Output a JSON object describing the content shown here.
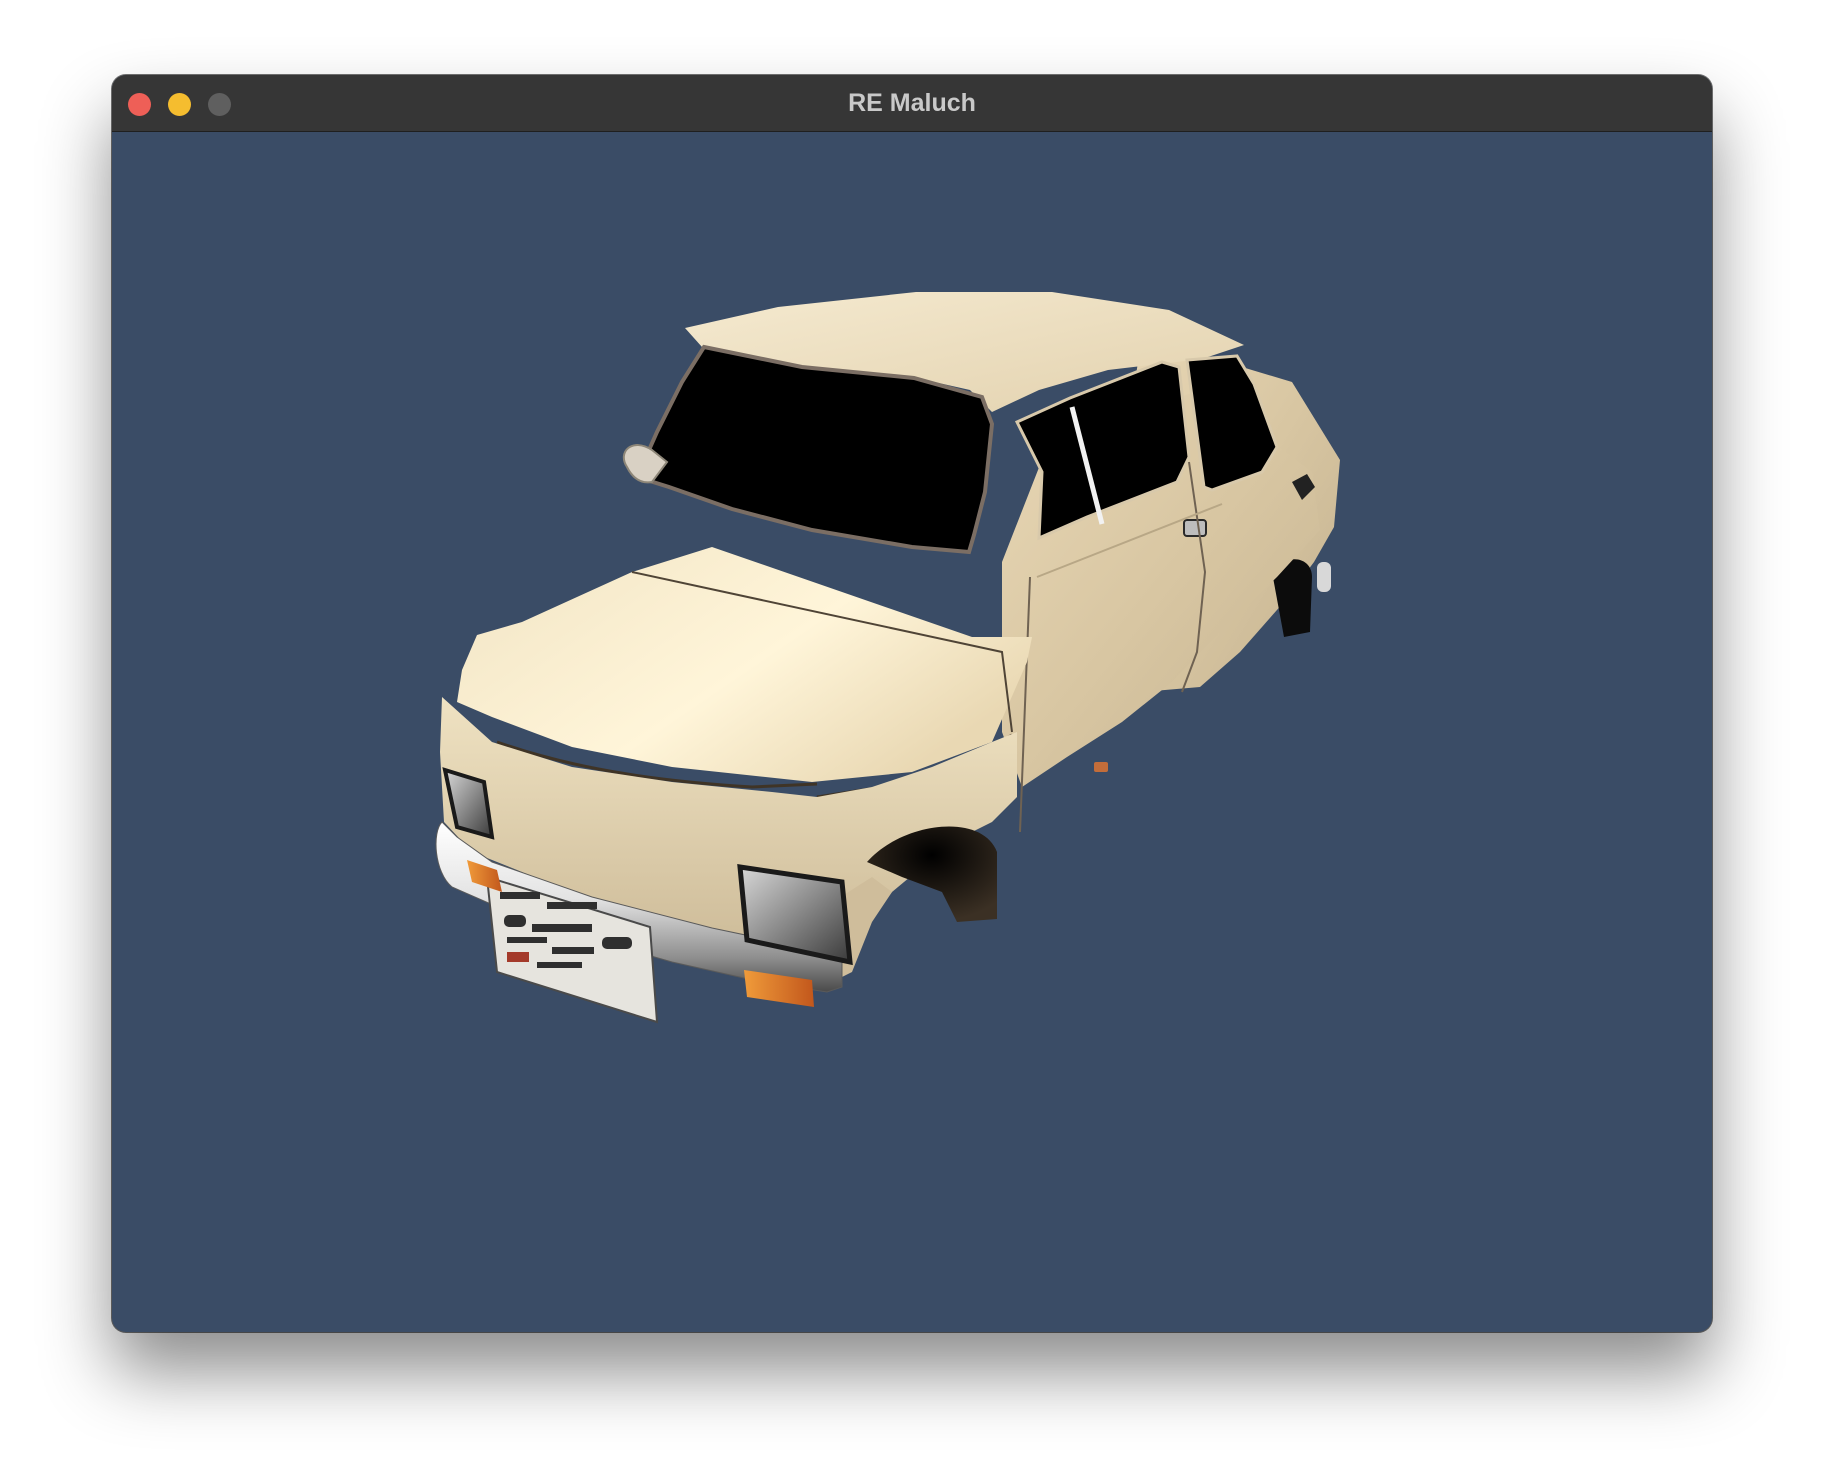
{
  "window": {
    "title": "RE Maluch",
    "buttons": {
      "close_color": "#ee5f57",
      "minimize_color": "#f5bd2f",
      "zoom_color": "#5f5f5f"
    }
  },
  "viewport": {
    "background_color": "#3a4c66",
    "scene_object": "car-body-3d-model",
    "car_color": "#ead9b6"
  }
}
